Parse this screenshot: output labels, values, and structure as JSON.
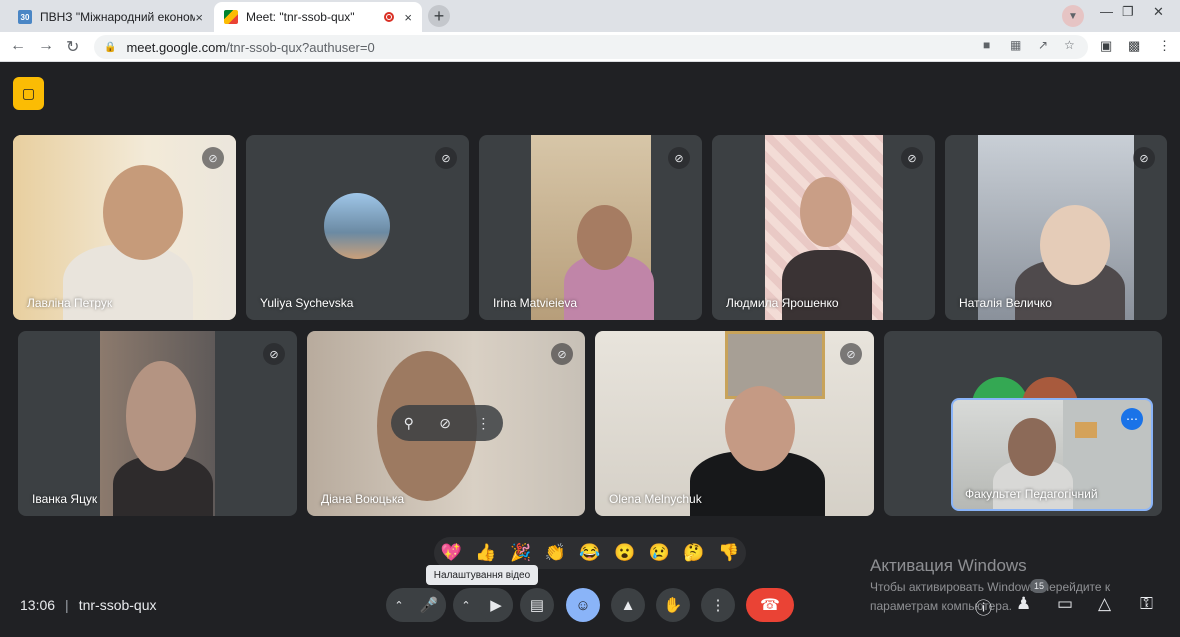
{
  "browser": {
    "tabs": [
      {
        "favicon": "30",
        "title": "ПВНЗ \"Міжнародний економіко",
        "close": "×"
      },
      {
        "favicon": "meet",
        "title": "Meet: \"tnr-ssob-qux\"",
        "close": "×"
      }
    ],
    "new_tab": "+",
    "url_host": "meet.google.com",
    "url_path": "/tnr-ssob-qux?authuser=0"
  },
  "tiles": [
    {
      "name": "Лавліна Петрук"
    },
    {
      "name": "Yuliya Sychevska"
    },
    {
      "name": "Irina Matvieieva"
    },
    {
      "name": "Людмила Ярошенко"
    },
    {
      "name": "Наталія Величко"
    },
    {
      "name": "Іванка Яцук"
    },
    {
      "name": "Діана Воюцька"
    },
    {
      "name": "Olena Melnychuk"
    }
  ],
  "self_view": {
    "name": "Факультет Педагогічний"
  },
  "reactions": [
    "💖",
    "👍",
    "🎉",
    "👏",
    "😂",
    "😮",
    "😢",
    "🤔",
    "👎"
  ],
  "tooltip": "Налаштування відео",
  "meeting": {
    "time": "13:06",
    "separator": "|",
    "code": "tnr-ssob-qux"
  },
  "watermark": {
    "title": "Активация Windows",
    "line1": "Чтобы активировать Windows, перейдите к",
    "line2": "параметрам компьютера."
  },
  "participants_count": "15",
  "colors": {
    "accent_blue": "#8ab4f8",
    "end_call_red": "#ea4335",
    "alert_yellow": "#fbbc04"
  }
}
